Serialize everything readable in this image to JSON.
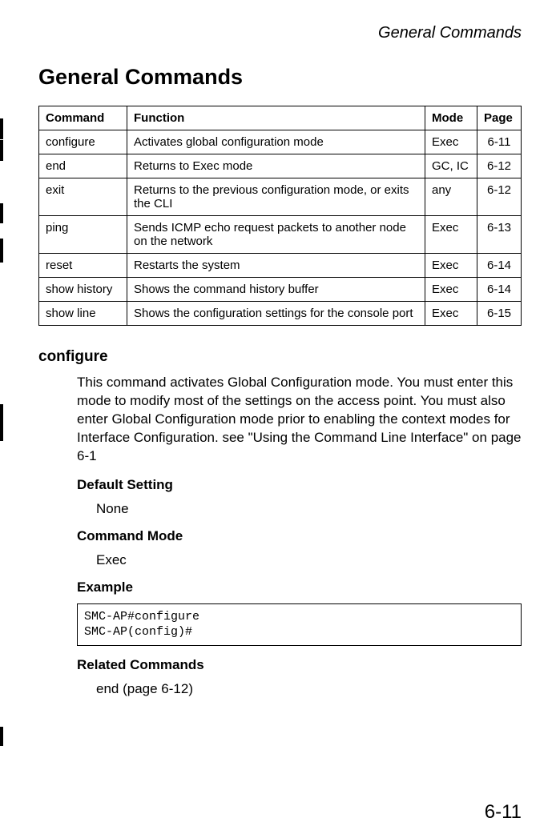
{
  "header": {
    "running_title": "General Commands"
  },
  "main": {
    "heading": "General Commands"
  },
  "table": {
    "headers": {
      "command": "Command",
      "function": "Function",
      "mode": "Mode",
      "page": "Page"
    },
    "rows": [
      {
        "command": "configure",
        "function": "Activates global configuration mode",
        "mode": "Exec",
        "page": "6-11"
      },
      {
        "command": "end",
        "function": "Returns to Exec mode",
        "mode": "GC, IC",
        "page": "6-12"
      },
      {
        "command": "exit",
        "function": "Returns to the previous configuration mode, or exits the CLI",
        "mode": "any",
        "page": "6-12"
      },
      {
        "command": "ping",
        "function": "Sends ICMP echo request packets to another node on the network",
        "mode": "Exec",
        "page": "6-13"
      },
      {
        "command": "reset",
        "function": "Restarts the system",
        "mode": "Exec",
        "page": "6-14"
      },
      {
        "command": "show history",
        "function": "Shows the command history buffer",
        "mode": "Exec",
        "page": "6-14"
      },
      {
        "command": "show line",
        "function": "Shows the configuration settings for the console port",
        "mode": "Exec",
        "page": "6-15"
      }
    ]
  },
  "section": {
    "heading": "configure",
    "description": "This command activates Global Configuration mode. You must enter this mode to modify most of the settings on the access point. You must also enter Global Configuration mode prior to enabling the context modes for Interface Configuration. see \"Using the Command Line Interface\" on page 6-1",
    "default_heading": "Default Setting",
    "default_value": "None",
    "mode_heading": "Command Mode",
    "mode_value": "Exec",
    "example_heading": "Example",
    "example_code": "SMC-AP#configure\nSMC-AP(config)#",
    "related_heading": "Related Commands",
    "related_value": "end (page 6-12)"
  },
  "page_number": "6-11",
  "chart_data": {
    "type": "table",
    "title": "General Commands",
    "columns": [
      "Command",
      "Function",
      "Mode",
      "Page"
    ],
    "rows": [
      [
        "configure",
        "Activates global configuration mode",
        "Exec",
        "6-11"
      ],
      [
        "end",
        "Returns to Exec mode",
        "GC, IC",
        "6-12"
      ],
      [
        "exit",
        "Returns to the previous configuration mode, or exits the CLI",
        "any",
        "6-12"
      ],
      [
        "ping",
        "Sends ICMP echo request packets to another node on the network",
        "Exec",
        "6-13"
      ],
      [
        "reset",
        "Restarts the system",
        "Exec",
        "6-14"
      ],
      [
        "show history",
        "Shows the command history buffer",
        "Exec",
        "6-14"
      ],
      [
        "show line",
        "Shows the configuration settings for the console port",
        "Exec",
        "6-15"
      ]
    ]
  }
}
